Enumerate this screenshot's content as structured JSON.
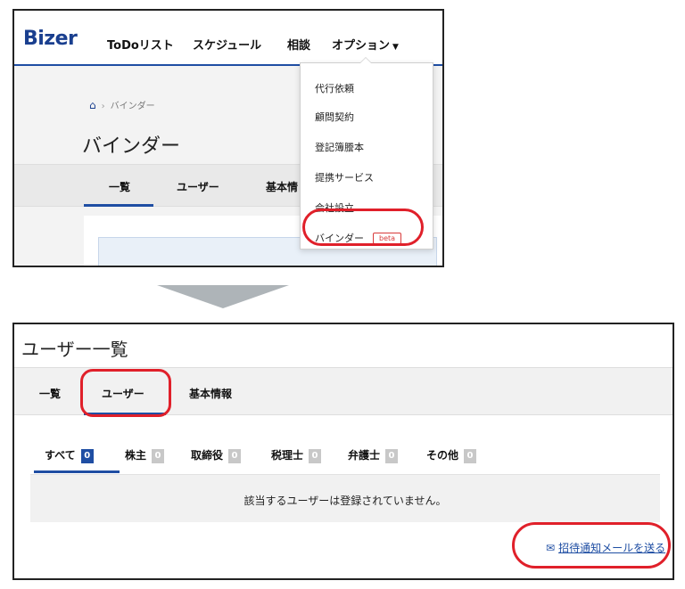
{
  "top": {
    "brand": "Bizer",
    "nav": {
      "todo": "ToDoリスト",
      "schedule": "スケジュール",
      "consult": "相談",
      "option": "オプション"
    },
    "breadcrumb": {
      "home_icon": "home-icon",
      "current": "バインダー"
    },
    "page_title": "バインダー",
    "tabs": {
      "list": "一覧",
      "users": "ユーザー",
      "basic": "基本情"
    },
    "dropdown": {
      "items": [
        "代行依頼",
        "顧問契約",
        "登記簿謄本",
        "提携サービス",
        "会社設立",
        "バインダー"
      ],
      "badge": "beta"
    }
  },
  "bottom": {
    "title": "ユーザー一覧",
    "tabs": {
      "list": "一覧",
      "users": "ユーザー",
      "basic": "基本情報"
    },
    "filters": [
      {
        "label": "すべて",
        "count": "0"
      },
      {
        "label": "株主",
        "count": "0"
      },
      {
        "label": "取締役",
        "count": "0"
      },
      {
        "label": "税理士",
        "count": "0"
      },
      {
        "label": "弁護士",
        "count": "0"
      },
      {
        "label": "その他",
        "count": "0"
      }
    ],
    "empty_message": "該当するユーザーは登録されていません。",
    "invite_link": "招待通知メールを送る"
  },
  "colors": {
    "brand": "#1a3f8f",
    "accent": "#1f4ea3",
    "highlight": "#e0202a",
    "beta": "#d83a3a"
  }
}
